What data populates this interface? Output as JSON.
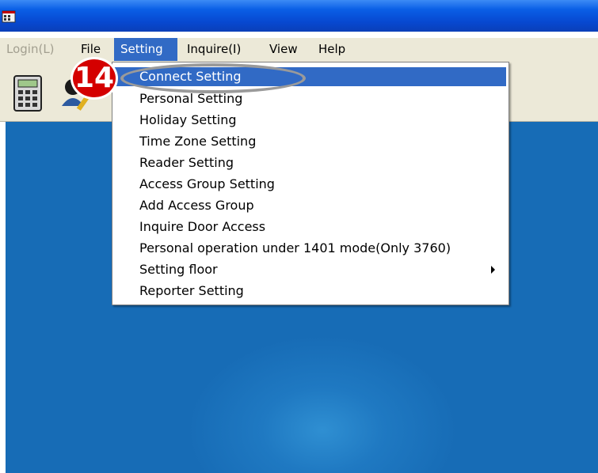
{
  "menubar": {
    "items": [
      {
        "label": "Login(L)",
        "state": "disabled"
      },
      {
        "label": "File",
        "state": "normal"
      },
      {
        "label": "Setting",
        "state": "active"
      },
      {
        "label": "Inquire(I)",
        "state": "normal"
      },
      {
        "label": "View",
        "state": "normal"
      },
      {
        "label": "Help",
        "state": "normal"
      }
    ]
  },
  "toolbar": {
    "buttons": [
      {
        "icon": "calculator-icon"
      },
      {
        "icon": "user-edit-icon"
      }
    ]
  },
  "setting_menu": {
    "items": [
      {
        "label": "Connect Setting",
        "highlighted": true
      },
      {
        "label": "Personal Setting"
      },
      {
        "label": "Holiday Setting"
      },
      {
        "label": "Time Zone Setting"
      },
      {
        "label": "Reader Setting"
      },
      {
        "label": "Access Group Setting"
      },
      {
        "label": "Add Access Group"
      },
      {
        "label": "Inquire Door Access"
      },
      {
        "label": "Personal operation under 1401 mode(Only 3760)"
      },
      {
        "label": "Setting floor",
        "has_submenu": true
      },
      {
        "label": "Reporter Setting"
      }
    ]
  },
  "callout": {
    "step_number": "14",
    "badge_color": "#d40000",
    "ellipse_color": "#9a9a9a"
  },
  "colors": {
    "titlebar": "#0a5fe6",
    "menu_highlight": "#316ac5",
    "desktop": "#176cb6"
  }
}
